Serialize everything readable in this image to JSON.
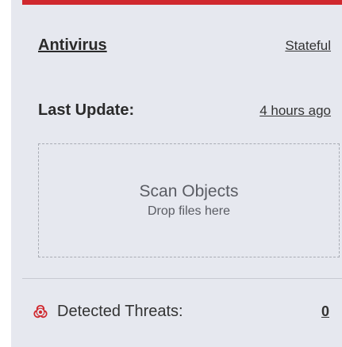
{
  "card": {
    "accent_color": "#d0282e",
    "background_color": "#e6e8ef",
    "title": "Antivirus",
    "mode": "Stateful",
    "last_update_label": "Last Update:",
    "last_update_value": "4 hours ago"
  },
  "dropzone": {
    "title": "Scan Objects",
    "subtitle": "Drop files here"
  },
  "threats": {
    "icon": "biohazard-icon",
    "label": "Detected Threats:",
    "count": "0"
  }
}
